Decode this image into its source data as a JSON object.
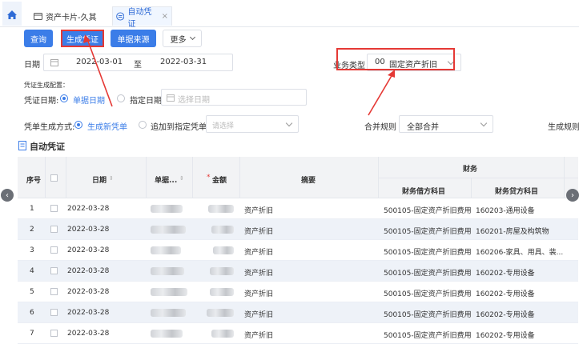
{
  "tabs": [
    {
      "label": "资产卡片-久其"
    },
    {
      "label": "自动凭证",
      "close": "×"
    }
  ],
  "toolbar": {
    "query": "查询",
    "generate": "生成凭证",
    "source": "单据来源",
    "more": "更多"
  },
  "filters": {
    "date_label": "日期",
    "date_from": "2022-03-01",
    "date_to_sep": "至",
    "date_to": "2022-03-31",
    "biz_type_label": "业务类型",
    "biz_type_value": "00",
    "biz_type_text": "固定资产折旧"
  },
  "config": {
    "title": "凭证生成配置：",
    "voucher_date_label": "凭证日期:",
    "opt_doc_date": "单据日期",
    "opt_fixed_date": "指定日期",
    "fixed_date_placeholder": "选择日期"
  },
  "method": {
    "label": "凭单生成方式:",
    "opt_new": "生成新凭单",
    "opt_append": "追加到指定凭单",
    "append_placeholder": "请选择",
    "merge_label": "合并规则",
    "merge_value": "全部合并",
    "gen_rule_label": "生成规则"
  },
  "section_title": "自动凭证",
  "table": {
    "headers": {
      "seq": "序号",
      "date": "日期",
      "doc": "单据...",
      "amount": "金额",
      "summary": "摘要",
      "finance": "财务",
      "debit": "财务借方科目",
      "credit": "财务贷方科目"
    },
    "rows": [
      {
        "seq": "1",
        "date": "2022-03-28",
        "summary": "资产折旧",
        "debit": "500105-固定资产折旧费用",
        "credit": "160203-通用设备"
      },
      {
        "seq": "2",
        "date": "2022-03-28",
        "summary": "资产折旧",
        "debit": "500105-固定资产折旧费用",
        "credit": "160201-房屋及构筑物"
      },
      {
        "seq": "3",
        "date": "2022-03-28",
        "summary": "资产折旧",
        "debit": "500105-固定资产折旧费用",
        "credit": "160206-家具、用具、装..."
      },
      {
        "seq": "4",
        "date": "2022-03-28",
        "summary": "资产折旧",
        "debit": "500105-固定资产折旧费用",
        "credit": "160202-专用设备"
      },
      {
        "seq": "5",
        "date": "2022-03-28",
        "summary": "资产折旧",
        "debit": "500105-固定资产折旧费用",
        "credit": "160202-专用设备"
      },
      {
        "seq": "6",
        "date": "2022-03-28",
        "summary": "资产折旧",
        "debit": "500105-固定资产折旧费用",
        "credit": "160202-专用设备"
      },
      {
        "seq": "7",
        "date": "2022-03-28",
        "summary": "资产折旧",
        "debit": "500105-固定资产折旧费用",
        "credit": "160202-专用设备"
      }
    ]
  },
  "colors": {
    "primary": "#3b7de8",
    "annotation": "#e53935"
  }
}
